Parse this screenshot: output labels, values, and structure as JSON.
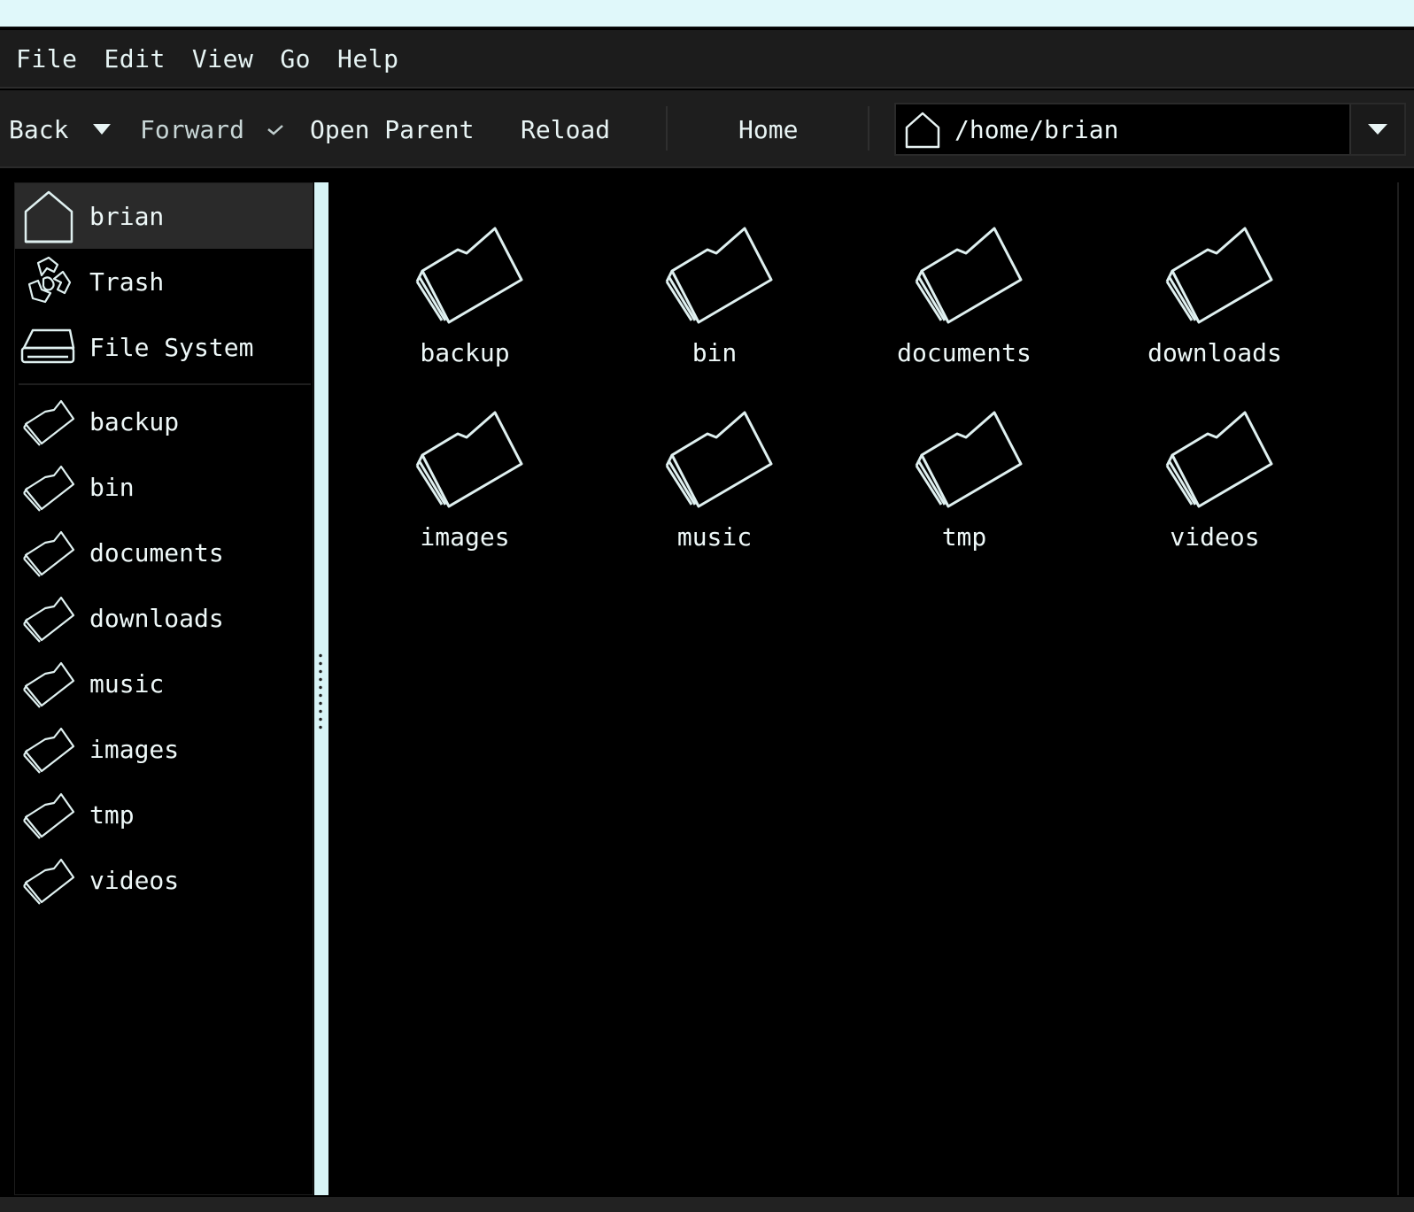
{
  "menu": {
    "file": "File",
    "edit": "Edit",
    "view": "View",
    "go": "Go",
    "help": "Help"
  },
  "toolbar": {
    "back": "Back",
    "forward": "Forward",
    "open_parent": "Open Parent",
    "reload": "Reload",
    "home": "Home"
  },
  "location": {
    "path": "/home/brian"
  },
  "sidebar": {
    "places": [
      {
        "label": "brian",
        "icon": "home-icon",
        "selected": true
      },
      {
        "label": "Trash",
        "icon": "trash-icon"
      },
      {
        "label": "File System",
        "icon": "drive-icon"
      }
    ],
    "bookmarks": [
      {
        "label": "backup",
        "icon": "folder-icon"
      },
      {
        "label": "bin",
        "icon": "folder-icon"
      },
      {
        "label": "documents",
        "icon": "folder-icon"
      },
      {
        "label": "downloads",
        "icon": "folder-icon"
      },
      {
        "label": "music",
        "icon": "folder-icon"
      },
      {
        "label": "images",
        "icon": "folder-icon"
      },
      {
        "label": "tmp",
        "icon": "folder-icon"
      },
      {
        "label": "videos",
        "icon": "folder-icon"
      }
    ]
  },
  "files": [
    {
      "name": "backup",
      "icon": "folder-icon"
    },
    {
      "name": "bin",
      "icon": "folder-icon"
    },
    {
      "name": "documents",
      "icon": "folder-icon"
    },
    {
      "name": "downloads",
      "icon": "folder-icon"
    },
    {
      "name": "images",
      "icon": "folder-icon"
    },
    {
      "name": "music",
      "icon": "folder-icon"
    },
    {
      "name": "tmp",
      "icon": "folder-icon"
    },
    {
      "name": "videos",
      "icon": "folder-icon"
    }
  ],
  "colors": {
    "background": "#000000",
    "foreground": "#e6f7f7",
    "accent": "#d8f4f6",
    "selection": "#2a2a2a"
  }
}
